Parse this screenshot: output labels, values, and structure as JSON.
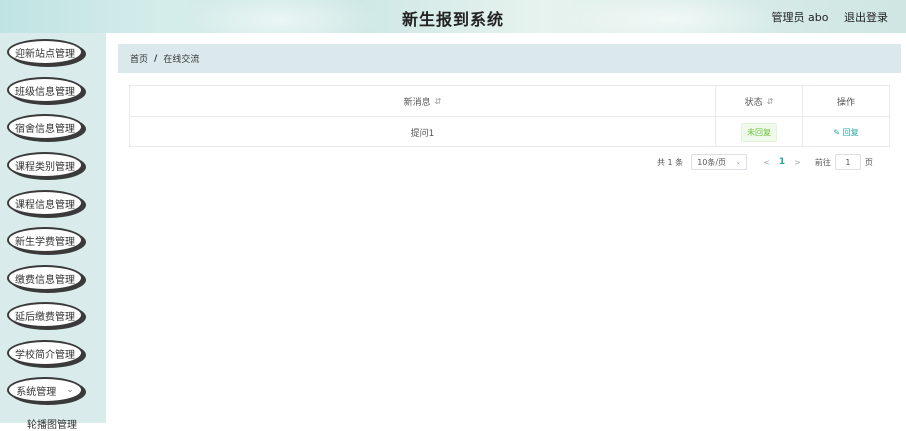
{
  "header": {
    "title": "新生报到系统",
    "user_label": "管理员 abo",
    "logout_label": "退出登录"
  },
  "sidebar": {
    "items": [
      {
        "label": "迎新站点管理"
      },
      {
        "label": "班级信息管理"
      },
      {
        "label": "宿舍信息管理"
      },
      {
        "label": "课程类别管理"
      },
      {
        "label": "课程信息管理"
      },
      {
        "label": "新生学费管理"
      },
      {
        "label": "缴费信息管理"
      },
      {
        "label": "延后缴费管理"
      },
      {
        "label": "学校简介管理"
      },
      {
        "label": "系统管理"
      }
    ],
    "submenu_partial": "轮播图管理"
  },
  "breadcrumb": {
    "home": "首页",
    "separator": "/",
    "current": "在线交流"
  },
  "table": {
    "columns": [
      "新消息",
      "状态",
      "操作"
    ],
    "rows": [
      {
        "message": "提问1",
        "status": "未回复",
        "action": "回复"
      }
    ]
  },
  "pagination": {
    "total": "共 1 条",
    "page_size": "10条/页",
    "current_page": "1",
    "goto_label": "前往",
    "goto_value": "1",
    "page_suffix": "页"
  },
  "colors": {
    "accent": "#25a9a3",
    "status_green": "#67c23a",
    "sidebar_bg": "#d9eceb",
    "breadcrumb_bg": "#dbe9ec"
  },
  "icons": {
    "sort": "sort-caret-icon",
    "edit": "edit-icon",
    "chevron": "chevron-down-icon",
    "prev": "chevron-left-icon",
    "next": "chevron-right-icon"
  }
}
